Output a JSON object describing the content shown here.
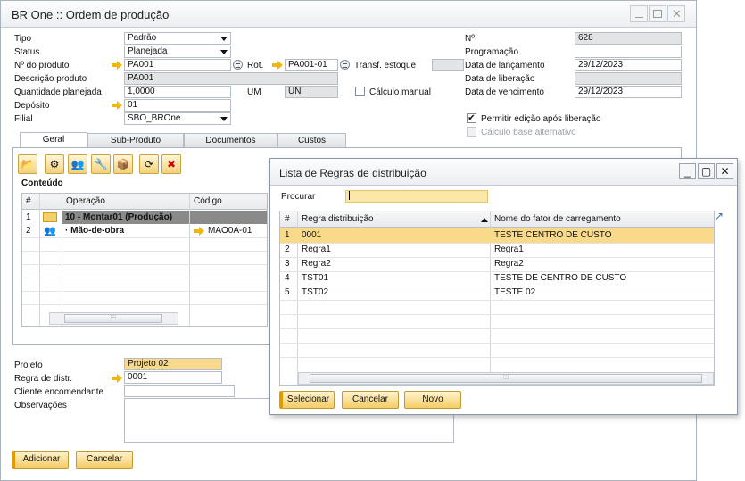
{
  "window": {
    "title": "BR One :: Ordem de produção"
  },
  "form": {
    "tipo_label": "Tipo",
    "tipo_value": "Padrão",
    "status_label": "Status",
    "status_value": "Planejada",
    "nprod_label": "Nº do produto",
    "nprod_value": "PA001",
    "rot_label": "Rot.",
    "rot_value": "PA001-01",
    "transf_label": "Transf. estoque",
    "desc_label": "Descrição produto",
    "desc_value": "PA001",
    "qtd_label": "Quantidade planejada",
    "qtd_value": "1,0000",
    "um_label": "UM",
    "um_value": "UN",
    "calc_manual_label": "Cálculo manual",
    "deposito_label": "Depósito",
    "deposito_value": "01",
    "filial_label": "Filial",
    "filial_value": "SBO_BROne",
    "n_label": "Nº",
    "n_value": "628",
    "prog_label": "Programação",
    "prog_value": "",
    "lanc_label": "Data de lançamento",
    "lanc_value": "29/12/2023",
    "lib_label": "Data de liberação",
    "lib_value": "",
    "venc_label": "Data de vencimento",
    "venc_value": "29/12/2023",
    "permitir_label": "Permitir edição após liberação",
    "calc_base_label": "Cálculo base alternativo"
  },
  "tabs": [
    {
      "label": "Geral"
    },
    {
      "label": "Sub-Produto"
    },
    {
      "label": "Documentos"
    },
    {
      "label": "Custos"
    }
  ],
  "content": {
    "section_label": "Conteúdo",
    "columns": [
      "#",
      "",
      "Operação",
      "Código"
    ],
    "rows": [
      {
        "num": "1",
        "op": "10 - Montar01 (Produção)",
        "code": ""
      },
      {
        "num": "2",
        "op": "·      Mão-de-obra",
        "code": "MAO0A-01"
      }
    ]
  },
  "bottom": {
    "projeto_label": "Projeto",
    "projeto_value": "Projeto 02",
    "regra_label": "Regra de distr.",
    "regra_value": "0001",
    "cliente_label": "Cliente encomendante",
    "cliente_value": "",
    "obs_label": "Observações"
  },
  "buttons": {
    "adicionar": "Adicionar",
    "cancelar": "Cancelar"
  },
  "dialog": {
    "title": "Lista de Regras de distribuição",
    "search_label": "Procurar",
    "search_value": "",
    "columns": [
      "#",
      "Regra distribuição",
      "Nome do fator de carregamento"
    ],
    "rows": [
      {
        "num": "1",
        "regra": "0001",
        "nome": "TESTE CENTRO DE CUSTO"
      },
      {
        "num": "2",
        "regra": "Regra1",
        "nome": "Regra1"
      },
      {
        "num": "3",
        "regra": "Regra2",
        "nome": "Regra2"
      },
      {
        "num": "4",
        "regra": "TST01",
        "nome": "TESTE DE CENTRO DE CUSTO"
      },
      {
        "num": "5",
        "regra": "TST02",
        "nome": "TESTE 02"
      }
    ],
    "buttons": {
      "selecionar": "Selecionar",
      "cancelar": "Cancelar",
      "novo": "Novo"
    }
  },
  "colors": {
    "highlight": "#f9d98a",
    "accent": "#f2b705",
    "selected_row": "#8a8a8a"
  }
}
